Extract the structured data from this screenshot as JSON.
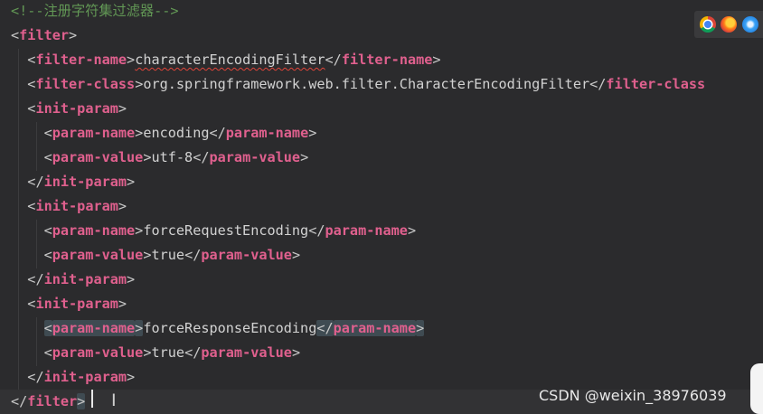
{
  "editor": {
    "language": "xml",
    "lines": [
      {
        "indent": "",
        "tokens": [
          [
            "comment",
            "<!--注册字符集过滤器-->"
          ]
        ]
      },
      {
        "indent": "",
        "tokens": [
          [
            "br",
            "<"
          ],
          [
            "tag",
            "filter"
          ],
          [
            "br",
            ">"
          ]
        ]
      },
      {
        "indent": "  ",
        "tokens": [
          [
            "br",
            "<"
          ],
          [
            "tag",
            "filter-name"
          ],
          [
            "br",
            ">"
          ],
          [
            "text",
            "characterEncodingFilter",
            "squiggle"
          ],
          [
            "br",
            "</"
          ],
          [
            "tag",
            "filter-name"
          ],
          [
            "br",
            ">"
          ]
        ]
      },
      {
        "indent": "  ",
        "tokens": [
          [
            "br",
            "<"
          ],
          [
            "tag",
            "filter-class"
          ],
          [
            "br",
            ">"
          ],
          [
            "text",
            "org.springframework.web.filter.CharacterEncodingFilter"
          ],
          [
            "br",
            "</"
          ],
          [
            "tag",
            "filter-class"
          ]
        ]
      },
      {
        "indent": "  ",
        "tokens": [
          [
            "br",
            "<"
          ],
          [
            "tag",
            "init-param"
          ],
          [
            "br",
            ">"
          ]
        ]
      },
      {
        "indent": "    ",
        "tokens": [
          [
            "br",
            "<"
          ],
          [
            "tag",
            "param-name"
          ],
          [
            "br",
            ">"
          ],
          [
            "text",
            "encoding"
          ],
          [
            "br",
            "</"
          ],
          [
            "tag",
            "param-name"
          ],
          [
            "br",
            ">"
          ]
        ]
      },
      {
        "indent": "    ",
        "tokens": [
          [
            "br",
            "<"
          ],
          [
            "tag",
            "param-value"
          ],
          [
            "br",
            ">"
          ],
          [
            "text",
            "utf-8"
          ],
          [
            "br",
            "</"
          ],
          [
            "tag",
            "param-value"
          ],
          [
            "br",
            ">"
          ]
        ]
      },
      {
        "indent": "  ",
        "tokens": [
          [
            "br",
            "</"
          ],
          [
            "tag",
            "init-param"
          ],
          [
            "br",
            ">"
          ]
        ]
      },
      {
        "indent": "  ",
        "tokens": [
          [
            "br",
            "<"
          ],
          [
            "tag",
            "init-param"
          ],
          [
            "br",
            ">"
          ]
        ]
      },
      {
        "indent": "    ",
        "tokens": [
          [
            "br",
            "<"
          ],
          [
            "tag",
            "param-name"
          ],
          [
            "br",
            ">"
          ],
          [
            "text",
            "forceRequestEncoding"
          ],
          [
            "br",
            "</"
          ],
          [
            "tag",
            "param-name"
          ],
          [
            "br",
            ">"
          ]
        ]
      },
      {
        "indent": "    ",
        "tokens": [
          [
            "br",
            "<"
          ],
          [
            "tag",
            "param-value"
          ],
          [
            "br",
            ">"
          ],
          [
            "text",
            "true"
          ],
          [
            "br",
            "</"
          ],
          [
            "tag",
            "param-value"
          ],
          [
            "br",
            ">"
          ]
        ]
      },
      {
        "indent": "  ",
        "tokens": [
          [
            "br",
            "</"
          ],
          [
            "tag",
            "init-param"
          ],
          [
            "br",
            ">"
          ]
        ]
      },
      {
        "indent": "  ",
        "tokens": [
          [
            "br",
            "<"
          ],
          [
            "tag",
            "init-param"
          ],
          [
            "br",
            ">"
          ]
        ]
      },
      {
        "indent": "    ",
        "tokens": [
          [
            "br",
            "<",
            "hl"
          ],
          [
            "tag",
            "param-name",
            "hl"
          ],
          [
            "br",
            ">",
            "hl"
          ],
          [
            "text",
            "forceResponseEncoding"
          ],
          [
            "br",
            "</",
            "hl"
          ],
          [
            "tag",
            "param-name",
            "hl"
          ],
          [
            "br",
            ">",
            "hl"
          ]
        ]
      },
      {
        "indent": "    ",
        "tokens": [
          [
            "br",
            "<"
          ],
          [
            "tag",
            "param-value"
          ],
          [
            "br",
            ">"
          ],
          [
            "text",
            "true"
          ],
          [
            "br",
            "</"
          ],
          [
            "tag",
            "param-value"
          ],
          [
            "br",
            ">"
          ]
        ]
      },
      {
        "indent": "  ",
        "tokens": [
          [
            "br",
            "</"
          ],
          [
            "tag",
            "init-param"
          ],
          [
            "br",
            ">"
          ]
        ]
      },
      {
        "indent": "",
        "tokens": [
          [
            "br",
            "</"
          ],
          [
            "tag",
            "filter"
          ],
          [
            "br",
            ">",
            "hl"
          ]
        ]
      }
    ]
  },
  "browser_icons": [
    "chrome-icon",
    "firefox-icon",
    "safari-icon"
  ],
  "watermark": "CSDN @weixin_38976039",
  "colors": {
    "background": "#2b2b2d",
    "tag": "#e0608e",
    "comment": "#629755",
    "text": "#d2d2d2",
    "bracket": "#c8c8c8",
    "match_highlight": "#3f4b52",
    "error_underline": "#e0443a"
  }
}
